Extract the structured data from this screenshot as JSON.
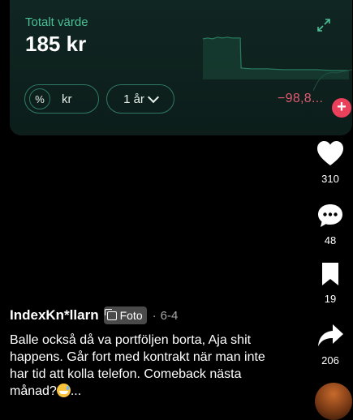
{
  "card": {
    "label": "Totalt värde",
    "value": "185 kr",
    "toggle_percent": "%",
    "toggle_currency": "kr",
    "period": "1 år",
    "change": "−98,8..."
  },
  "actions": {
    "likes": "310",
    "comments": "48",
    "saves": "19",
    "shares": "206"
  },
  "post": {
    "author": "IndexKn*llarn",
    "badge": "Foto",
    "separator": "·",
    "date": "6-4",
    "caption": "Balle också då va portföljen borta, Aja shit happens. Går fort med kontrakt när man inte har tid att kolla telefon. Comeback nästa månad?",
    "caption_more": "..."
  },
  "icons": [
    "expand-icon",
    "chevron-down-icon",
    "plus-icon",
    "heart-icon",
    "comment-icon",
    "bookmark-icon",
    "share-icon",
    "photo-icon"
  ],
  "colors": {
    "accent": "#4bbf96",
    "negative": "#e15a73",
    "plus_button": "#e9405b"
  }
}
